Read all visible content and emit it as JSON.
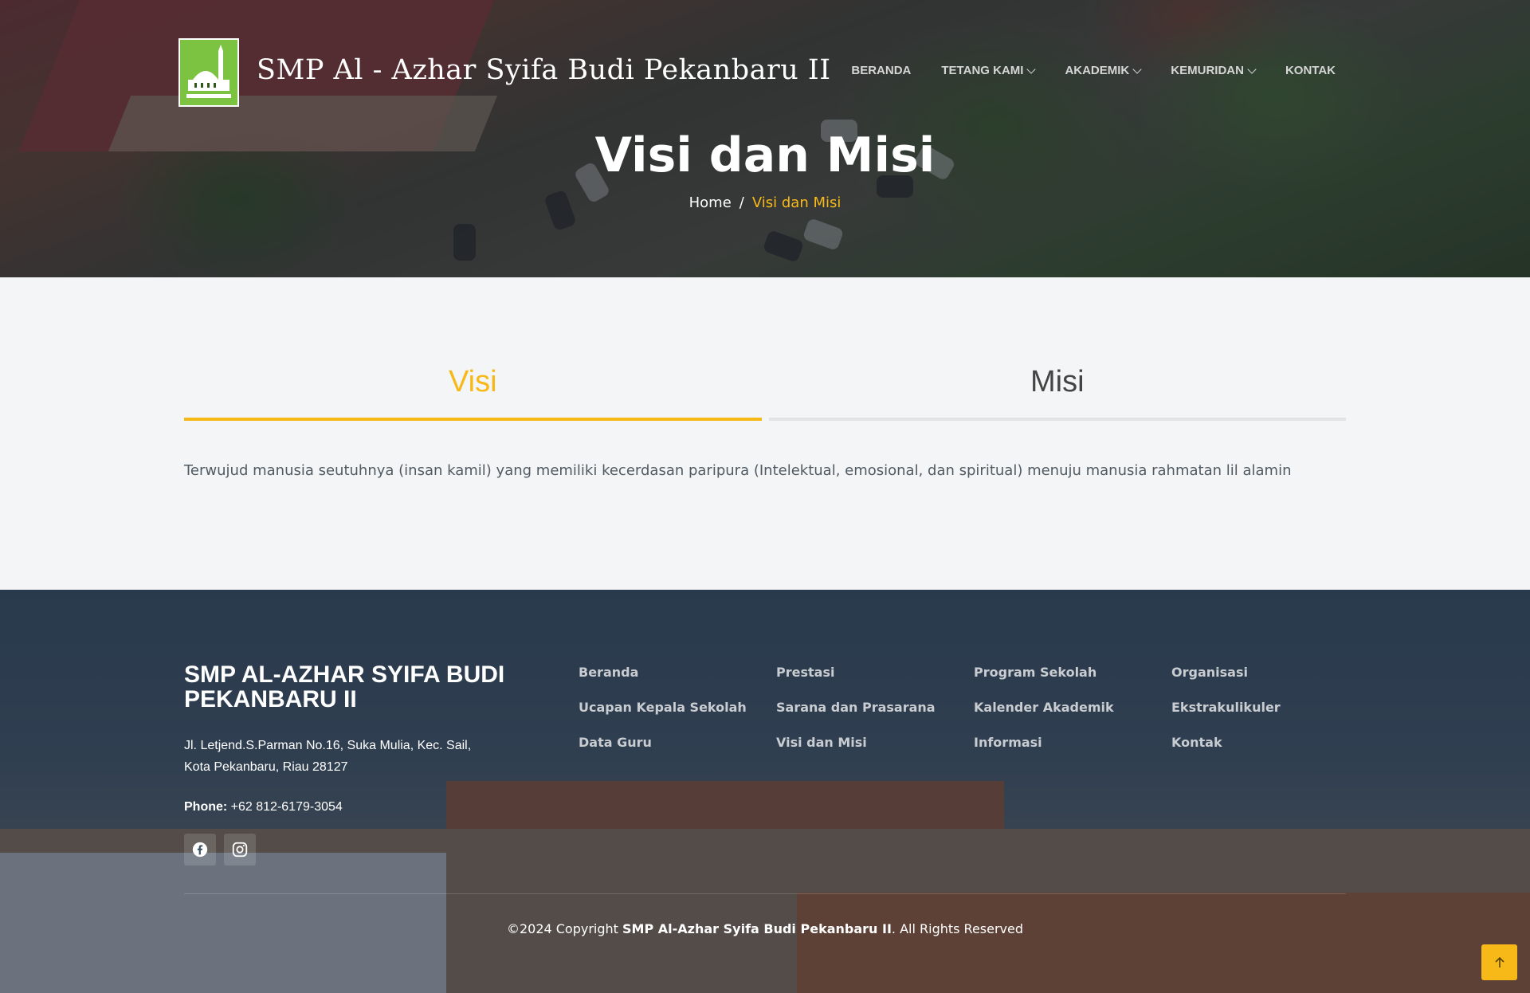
{
  "header": {
    "site_title": "SMP Al - Azhar Syifa Budi Pekanbaru II",
    "logo_caption": "Al-Azhar Syifa Budi Pekanbaru II",
    "nav": [
      {
        "label": "BERANDA"
      },
      {
        "label": "TETANG KAMI"
      },
      {
        "label": "AKADEMIK"
      },
      {
        "label": "KEMURIDAN"
      },
      {
        "label": "KONTAK"
      }
    ]
  },
  "hero": {
    "title": "Visi dan Misi",
    "breadcrumb_home": "Home",
    "breadcrumb_sep": "/",
    "breadcrumb_current": "Visi dan Misi"
  },
  "tabs": {
    "items": [
      {
        "label": "Visi",
        "active": true
      },
      {
        "label": "Misi",
        "active": false
      }
    ],
    "content": "Terwujud manusia seutuhnya (insan kamil) yang memiliki kecerdasan paripura (Intelektual, emosional, dan spiritual) menuju manusia rahmatan lil alamin"
  },
  "footer": {
    "brand": "SMP AL-AZHAR SYIFA BUDI PEKANBARU II",
    "address_line1": "Jl. Letjend.S.Parman No.16, Suka Mulia, Kec. Sail,",
    "address_line2": "Kota Pekanbaru, Riau 28127",
    "phone_label": "Phone:",
    "phone_value": "+62 812-6179-3054",
    "social": [
      "facebook-icon",
      "instagram-icon"
    ],
    "links": [
      "Beranda",
      "Prestasi",
      "Program Sekolah",
      "Organisasi",
      "Ucapan Kepala Sekolah",
      "Sarana dan Prasarana",
      "Kalender Akademik",
      "Ekstrakulikuler",
      "Data Guru",
      "Visi dan Misi",
      "Informasi",
      "Kontak"
    ],
    "copyright_prefix": "©2024 Copyright",
    "copyright_name": "SMP Al-Azhar Syifa Budi Pekanbaru II",
    "copyright_suffix": ". All Rights Reserved"
  },
  "colors": {
    "accent": "#f7b918",
    "logo_green": "#7dc342",
    "text": "#505a63"
  },
  "scroll_top_icon": "arrow-up-icon"
}
